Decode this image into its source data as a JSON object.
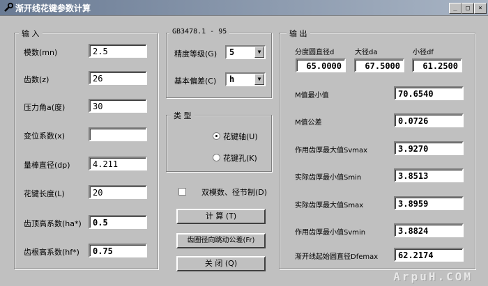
{
  "window": {
    "title": "渐开线花键参数计算",
    "minimize": "_",
    "maximize": "□",
    "close": "×"
  },
  "input": {
    "legend": "输  入",
    "fields": [
      {
        "label": "模数(mn)",
        "value": "2.5"
      },
      {
        "label": "齿数(z)",
        "value": "26"
      },
      {
        "label": "压力角a(度)",
        "value": "30"
      },
      {
        "label": "变位系数(x)",
        "value": ""
      },
      {
        "label": "量棒直径(dp)",
        "value": "4.211"
      },
      {
        "label": "花键长度(L)",
        "value": "20"
      },
      {
        "label": "齿顶高系数(ha*)",
        "value": "0.5"
      },
      {
        "label": "齿根高系数(hf*)",
        "value": "0.75"
      }
    ]
  },
  "standard": {
    "legend": "GB3478.1 - 95",
    "grade_label": "精度等级(G)",
    "grade_value": "5",
    "deviation_label": "基本偏差(C)",
    "deviation_value": "h"
  },
  "type": {
    "legend": "类  型",
    "options": [
      "花键轴(U)",
      "花键孔(K)"
    ],
    "selected": 0
  },
  "dual_module_label": "双模数、径节制(D)",
  "buttons": {
    "calc": "计  算 (T)",
    "runout": "齿圈径向跳动公差(Fr)",
    "close": "关  闭 (Q)"
  },
  "output": {
    "legend": "输  出",
    "pitch_label": "分度圆直径d",
    "major_label": "大径da",
    "minor_label": "小径df",
    "pitch_value": "65.0000",
    "major_value": "67.5000",
    "minor_value": "61.2500",
    "rows": [
      {
        "label": "M值最小值",
        "value": "70.6540"
      },
      {
        "label": "M值公差",
        "value": "0.0726"
      },
      {
        "label": "作用齿厚最大值Svmax",
        "value": "3.9270"
      },
      {
        "label": "实际齿厚最小值Smin",
        "value": "3.8513"
      },
      {
        "label": "实际齿厚最大值Smax",
        "value": "3.8959"
      },
      {
        "label": "作用齿厚最小值Svmin",
        "value": "3.8824"
      },
      {
        "label": "渐开线起始圆直径Dfemax",
        "value": "62.2174"
      }
    ]
  },
  "watermark": "ArpuH.COM"
}
